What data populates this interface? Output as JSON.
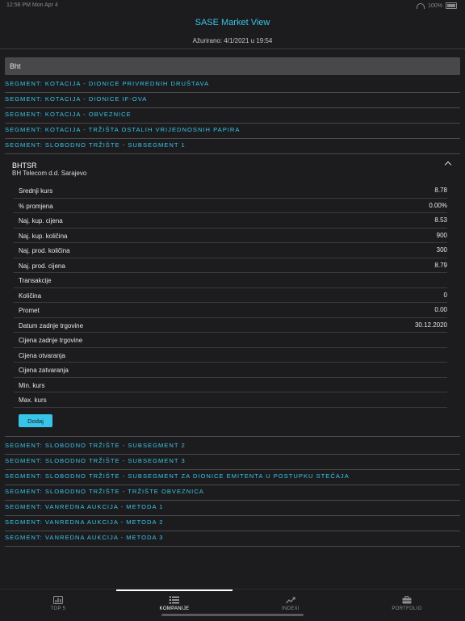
{
  "status_bar": {
    "left_text": "12:56 PM  Mon Apr 4",
    "right_text": "100%"
  },
  "header": {
    "title": "SASE Market View",
    "updated": "Ažurirano: 4/1/2021 u 19:54"
  },
  "search": {
    "value": "Bht"
  },
  "segments_top": [
    "SEGMENT: KOTACIJA - DIONICE PRIVREDNIH DRUŠTAVA",
    "SEGMENT: KOTACIJA - DIONICE IF-OVA",
    "SEGMENT: KOTACIJA - OBVEZNICE",
    "SEGMENT: KOTACIJA - TRŽIŠTA OSTALIH VRIJEDNOSNIH PAPIRA",
    "SEGMENT: SLOBODNO TRŽIŠTE - SUBSEGMENT 1"
  ],
  "company": {
    "ticker": "BHTSR",
    "name": "BH Telecom d.d. Sarajevo",
    "rows": [
      {
        "label": "Srednji kurs",
        "value": "8.78"
      },
      {
        "label": "% promjena",
        "value": "0.00%"
      },
      {
        "label": "Naj. kup. cijena",
        "value": "8.53"
      },
      {
        "label": "Naj. kup. količina",
        "value": "900"
      },
      {
        "label": "Naj. prod. količina",
        "value": "300"
      },
      {
        "label": "Naj. prod. cijena",
        "value": "8.79"
      },
      {
        "label": "Transakcije",
        "value": ""
      },
      {
        "label": "Količina",
        "value": "0"
      },
      {
        "label": "Promet",
        "value": "0.00"
      },
      {
        "label": "Datum zadnje trgovine",
        "value": "30.12.2020"
      },
      {
        "label": "Cijena zadnje trgovine",
        "value": ""
      },
      {
        "label": "Cijena otvaranja",
        "value": ""
      },
      {
        "label": "Cijena zatvaranja",
        "value": ""
      },
      {
        "label": "Min. kurs",
        "value": ""
      },
      {
        "label": "Max. kurs",
        "value": ""
      }
    ],
    "add_label": "Dodaj"
  },
  "segments_bottom": [
    "SEGMENT: SLOBODNO TRŽIŠTE - SUBSEGMENT 2",
    "SEGMENT: SLOBODNO TRŽIŠTE - SUBSEGMENT 3",
    "SEGMENT: SLOBODNO TRŽIŠTE - SUBSEGMENT ZA DIONICE EMITENTA U POSTUPKU STEČAJA",
    "SEGMENT: SLOBODNO TRŽIŠTE - TRŽIŠTE OBVEZNICA",
    "SEGMENT: VANREDNA AUKCIJA - METODA 1",
    "SEGMENT: VANREDNA AUKCIJA - METODA 2",
    "SEGMENT: VANREDNA AUKCIJA - METODA 3"
  ],
  "tabs": [
    {
      "label": "TOP 5",
      "icon": "bar-chart-icon",
      "active": false
    },
    {
      "label": "KOMPANIJE",
      "icon": "list-icon",
      "active": true
    },
    {
      "label": "INDEXI",
      "icon": "trend-line-icon",
      "active": false
    },
    {
      "label": "PORTFOLIO",
      "icon": "briefcase-icon",
      "active": false
    }
  ],
  "colors": {
    "accent": "#37c4e8",
    "background": "#1c1c1e",
    "search_bg": "#48484a"
  }
}
